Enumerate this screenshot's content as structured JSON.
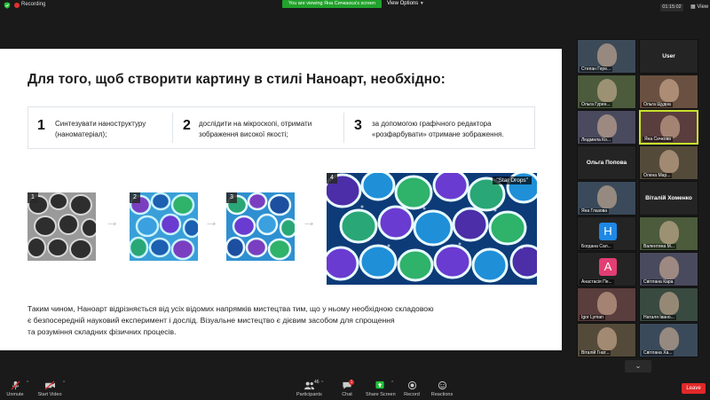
{
  "topbar": {
    "recording_label": "Recording",
    "viewing_banner": "You are viewing Яна Сичкаоєа's screen",
    "view_options_label": "View Options",
    "timer": "01:15:02",
    "view_label": "View"
  },
  "slide": {
    "title": "Для того, щоб створити картину в стилі Наноарт, необхідно:",
    "steps": [
      {
        "num": "1",
        "text_line1": "Синтезувати наноструктуру",
        "text_line2": "(наноматеріал);"
      },
      {
        "num": "2",
        "text_line1": "дослідити на мікроскопі, отримати",
        "text_line2": "зображення високої якості;"
      },
      {
        "num": "3",
        "text_line1": "за допомогою графічного редактора",
        "text_line2": "«розфарбувати» отримане зображення."
      }
    ],
    "images": [
      {
        "num": "1"
      },
      {
        "num": "2"
      },
      {
        "num": "3"
      },
      {
        "num": "4",
        "label": "\"Star Drops\""
      }
    ],
    "arrow": "→",
    "summary_line1": "Таким чином, Наноарт відрізняється від усіх відомих напрямків мистецтва тим, що у ньому необхідною складовою",
    "summary_line2": "є безпосередній науковий експеримент і дослід. Візуальне мистецтво є дієвим засобом для спрощення",
    "summary_line3": "та розуміння складних фізичних процесів."
  },
  "gallery": {
    "tiles": [
      {
        "name": "Степан Гере..."
      },
      {
        "bigname": "User"
      },
      {
        "name": "Ольга Гурен..."
      },
      {
        "name": "Ольга Щудна"
      },
      {
        "name": "Людмила Ко..."
      },
      {
        "name": "Яна Сичкова"
      },
      {
        "bigname": "Ольга Попова"
      },
      {
        "name": "Олена Мар..."
      },
      {
        "name": "Яна Глазова"
      },
      {
        "bigname": "Віталій Хоменко"
      },
      {
        "name": "Богдана Сал...",
        "letter": "Н",
        "letter_color": "#1e88e5"
      },
      {
        "name": "Валентина М..."
      },
      {
        "name": "Анастасія Пе...",
        "letter": "А",
        "letter_color": "#e23e73"
      },
      {
        "name": "Світлана Кара"
      },
      {
        "name": "Igor Lyman"
      },
      {
        "name": "Наталя Івано..."
      },
      {
        "name": "Віталій Гнат..."
      },
      {
        "name": "Світлана Ха..."
      }
    ],
    "down_icon": "chevron-down-icon"
  },
  "toolbar": {
    "unmute_label": "Unmute",
    "start_video_label": "Start Video",
    "participants_label": "Participants",
    "participants_count": "46",
    "chat_label": "Chat",
    "chat_badge": "1",
    "share_screen_label": "Share Screen",
    "record_label": "Record",
    "reactions_label": "Reactions",
    "leave_label": "Leave"
  },
  "colors": {
    "share_green": "#23c23a",
    "leave_red": "#e02828",
    "active_speaker": "#c8e02a",
    "banner_green": "#21a22b"
  }
}
